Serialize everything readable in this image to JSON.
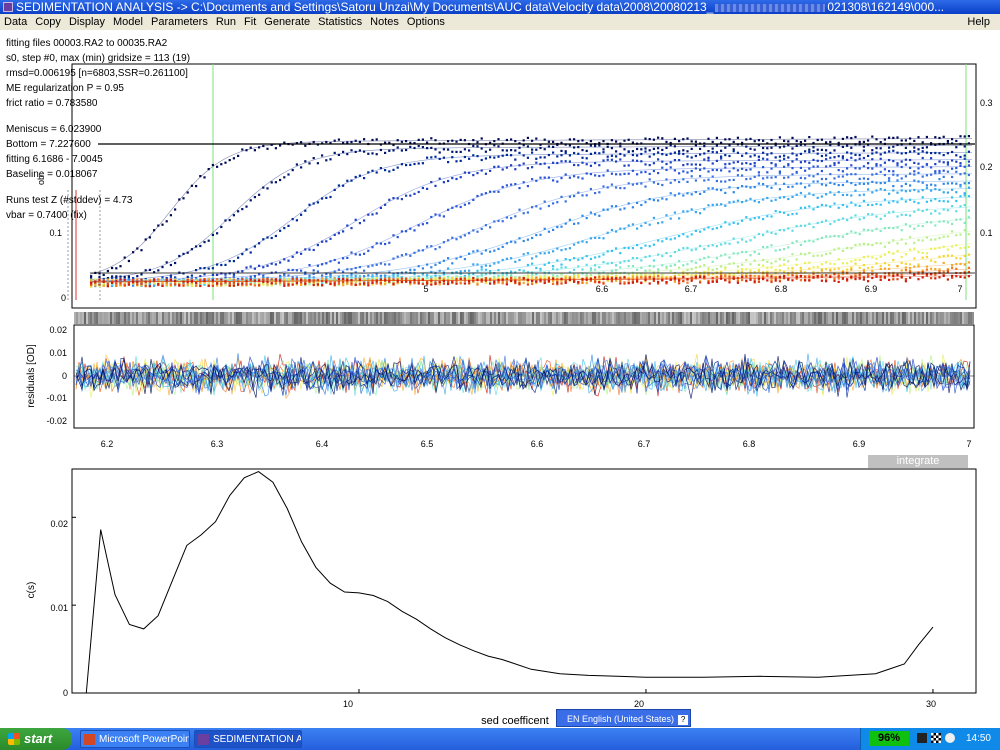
{
  "window": {
    "title": "SEDIMENTATION ANALYSIS -> C:\\Documents and Settings\\Satoru Unzai\\My Documents\\AUC data\\Velocity data\\2008\\20080213_",
    "title_tail": "021308\\162149\\000..."
  },
  "menu": {
    "items": [
      "Data",
      "Copy",
      "Display",
      "Model",
      "Parameters",
      "Run",
      "Fit",
      "Generate",
      "Statistics",
      "Notes",
      "Options"
    ],
    "help": "Help"
  },
  "fit_info": [
    "fitting files 00003.RA2 to 00035.RA2",
    "s0, step #0, max (min) gridsize = 113 (19)",
    "rmsd=0.006195 [n=6803,SSR=0.261100]",
    "ME regularization P = 0.95",
    "frict ratio = 0.783580",
    "",
    "Meniscus = 6.023900",
    "Bottom = 7.227600",
    "fitting 6.1686 - 7.0045",
    "Baseline = 0.018067",
    "",
    "Runs test Z (#stddev) = 4.73",
    "vbar = 0.7400 (fix)"
  ],
  "top_plot": {
    "ylabel": "ob",
    "x_ticks": [
      "5",
      "6.6",
      "6.7",
      "6.8",
      "6.9",
      "7"
    ],
    "y_ticks_left": [
      "0.1",
      "0"
    ],
    "y_ticks_right": [
      "0.3",
      "0.2",
      "0.1"
    ],
    "scan_colors": [
      "#000a55",
      "#00156e",
      "#002a9a",
      "#1d3fc1",
      "#2a55d8",
      "#3a70e0",
      "#2f86e8",
      "#39a6ee",
      "#37c2f0",
      "#5edbe2",
      "#86e8c0",
      "#b9ef8a",
      "#e8f05a",
      "#f7d63a",
      "#f7a82a",
      "#f2761e",
      "#e64614",
      "#d01a0a"
    ]
  },
  "residuals_plot": {
    "ylabel": "residuals [OD]",
    "y_ticks": [
      "0.02",
      "0.01",
      "0",
      "-0.01",
      "-0.02"
    ],
    "x_ticks": [
      "6.2",
      "6.3",
      "6.4",
      "6.5",
      "6.6",
      "6.7",
      "6.8",
      "6.9",
      "7"
    ]
  },
  "integrate_button": "integrate",
  "chart_data": {
    "type": "line",
    "xlabel": "sed coefficent",
    "ylabel": "c(s)",
    "x_ticks": [
      "10",
      "20",
      "30"
    ],
    "y_ticks": [
      "0.02",
      "0.01",
      "0"
    ],
    "xlim": [
      0,
      31.5
    ],
    "ylim": [
      0,
      0.0255
    ],
    "x": [
      0.5,
      1.0,
      1.5,
      2.0,
      2.5,
      3.0,
      3.5,
      4.0,
      4.5,
      5.0,
      5.5,
      6.0,
      6.5,
      7.0,
      7.5,
      8.0,
      8.5,
      9.0,
      9.5,
      10.0,
      10.5,
      11.0,
      11.5,
      12.0,
      12.5,
      13.0,
      13.5,
      14.0,
      14.5,
      15.0,
      16.0,
      17.0,
      18.0,
      19.0,
      20.0,
      22.0,
      24.0,
      26.0,
      28.0,
      29.0,
      29.5,
      30.0
    ],
    "y": [
      0.0,
      0.0186,
      0.0112,
      0.0078,
      0.0073,
      0.0088,
      0.0128,
      0.0168,
      0.018,
      0.0195,
      0.0225,
      0.0245,
      0.0252,
      0.024,
      0.021,
      0.0172,
      0.0143,
      0.0125,
      0.0115,
      0.0114,
      0.0111,
      0.0104,
      0.0093,
      0.0084,
      0.0073,
      0.0063,
      0.0055,
      0.0048,
      0.0042,
      0.0038,
      0.0027,
      0.0022,
      0.002,
      0.0019,
      0.0018,
      0.0018,
      0.0019,
      0.0018,
      0.0022,
      0.0033,
      0.0055,
      0.0075
    ]
  },
  "taskbar": {
    "start": "start",
    "tasks": [
      "Microsoft PowerPoint...",
      "SEDIMENTATION AN..."
    ],
    "language": "EN English (United States)",
    "battery": "96%",
    "clock": "14:50"
  }
}
